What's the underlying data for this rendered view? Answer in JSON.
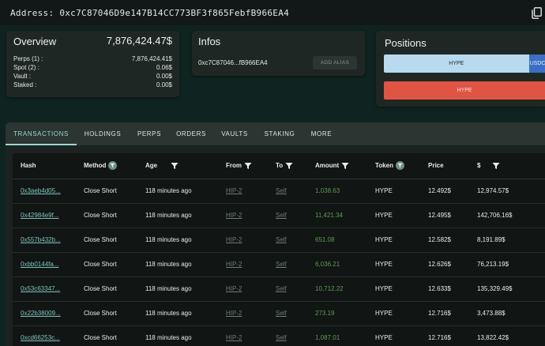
{
  "address": {
    "label": "Address:",
    "value": "0xc7C87046D9e147B14CC773BF3f865FebfB966EA4"
  },
  "overview": {
    "title": "Overview",
    "total": "7,876,424.47$",
    "rows": [
      {
        "label": "Perps (1) :",
        "value": "7,876,424.41$"
      },
      {
        "label": "Spot (2) :",
        "value": "0.06$"
      },
      {
        "label": "Vault :",
        "value": "0.00$"
      },
      {
        "label": "Staked :",
        "value": "0.00$"
      }
    ]
  },
  "infos": {
    "title": "Infos",
    "short_address": "0xc7C87046...fB966EA4",
    "alias_button": "ADD ALIAS"
  },
  "positions": {
    "title": "Positions",
    "long_bar": {
      "label": "HYPE",
      "secondary_label": "USDC",
      "fill_percent": 90
    },
    "short_bar": {
      "label": "HYPE"
    }
  },
  "tabs": [
    "TRANSACTIONS",
    "HOLDINGS",
    "PERPS",
    "ORDERS",
    "VAULTS",
    "STAKING",
    "MORE"
  ],
  "table": {
    "headers": {
      "hash": "Hash",
      "method": "Method",
      "age": "Age",
      "from": "From",
      "to": "To",
      "amount": "Amount",
      "token": "Token",
      "price": "Price",
      "usd": "$"
    },
    "rows": [
      {
        "hash": "0x3aeb4d05...",
        "method": "Close Short",
        "age": "118 minutes ago",
        "from": "HIP-2",
        "to": "Self",
        "amount": "1,038.63",
        "token": "HYPE",
        "price": "12.492$",
        "usd": "12,974.57$"
      },
      {
        "hash": "0x42984e9f...",
        "method": "Close Short",
        "age": "118 minutes ago",
        "from": "HIP-2",
        "to": "Self",
        "amount": "11,421.34",
        "token": "HYPE",
        "price": "12.495$",
        "usd": "142,706.16$"
      },
      {
        "hash": "0x557b432b...",
        "method": "Close Short",
        "age": "118 minutes ago",
        "from": "HIP-2",
        "to": "Self",
        "amount": "651.08",
        "token": "HYPE",
        "price": "12.582$",
        "usd": "8,191.89$"
      },
      {
        "hash": "0xbb0144fa...",
        "method": "Close Short",
        "age": "118 minutes ago",
        "from": "HIP-2",
        "to": "Self",
        "amount": "6,036.21",
        "token": "HYPE",
        "price": "12.626$",
        "usd": "76,213.19$"
      },
      {
        "hash": "0x53c63347...",
        "method": "Close Short",
        "age": "118 minutes ago",
        "from": "HIP-2",
        "to": "Self",
        "amount": "10,712.22",
        "token": "HYPE",
        "price": "12.633$",
        "usd": "135,329.49$"
      },
      {
        "hash": "0x22b38009...",
        "method": "Close Short",
        "age": "118 minutes ago",
        "from": "HIP-2",
        "to": "Self",
        "amount": "273.19",
        "token": "HYPE",
        "price": "12.716$",
        "usd": "3,473.88$"
      },
      {
        "hash": "0xcd66253c...",
        "method": "Close Short",
        "age": "118 minutes ago",
        "from": "HIP-2",
        "to": "Self",
        "amount": "1,087.01",
        "token": "HYPE",
        "price": "12.716$",
        "usd": "13,822.42$"
      }
    ]
  },
  "colors": {
    "background": "#0f2420",
    "accent": "#9ed7d0",
    "long_bar": "#b9daee",
    "usdc_bar": "#3a6fc4",
    "short_bar": "#e05444",
    "amount_text": "#5f9b56"
  },
  "icons": {
    "copy": "copy-icon",
    "filter": "filter-icon",
    "filter_active": "filter-active-icon"
  }
}
